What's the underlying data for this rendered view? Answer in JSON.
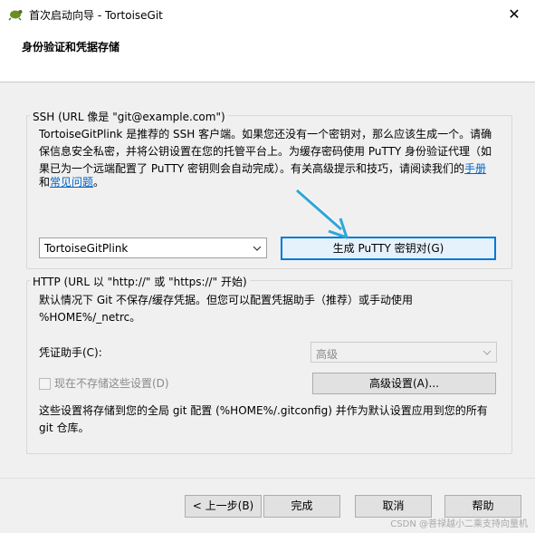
{
  "window": {
    "title": "首次启动向导 - TortoiseGit",
    "close_glyph": "✕"
  },
  "header": {
    "title": "身份验证和凭据存储"
  },
  "ssh": {
    "legend": "SSH (URL 像是 \"git@example.com\")",
    "line1": "TortoiseGitPlink 是推荐的 SSH 客户端。如果您还没有一个密钥对，那么应该生成一个。请确",
    "line2": "保信息安全私密，并将公钥设置在您的托管平台上。为缓存密码使用 PuTTY 身份验证代理（如",
    "line3": "果已为一个远端配置了 PuTTY 密钥则会自动完成）。有关高级提示和技巧，请阅读我们的",
    "link_manual": "手册",
    "and": "和",
    "link_faq": "常见问题",
    "period": "。",
    "client_value": "TortoiseGitPlink",
    "generate_button": "生成 PuTTY 密钥对(G)"
  },
  "http": {
    "legend": "HTTP (URL 以 \"http://\" 或 \"https://\" 开始)",
    "line1": "默认情况下 Git 不保存/缓存凭据。但您可以配置凭据助手（推荐）或手动使用",
    "line2": "%HOME%/_netrc。",
    "helper_label": "凭证助手(C):",
    "helper_value": "高级",
    "store_now_label": "现在不存储这些设置(D)",
    "advanced_button": "高级设置(A)...",
    "note1": "这些设置将存储到您的全局 git 配置 (%HOME%/.gitconfig) 并作为默认设置应用到您的所有",
    "note2": "git 仓库。"
  },
  "footer": {
    "back": "< 上一步(B)",
    "finish": "完成",
    "cancel": "取消",
    "help": "帮助"
  },
  "watermark": "CSDN @菩禄越小二乘支持向量机",
  "colors": {
    "accent": "#0078d7",
    "annotation_arrow": "#2ea6d8",
    "link": "#0066cc"
  }
}
